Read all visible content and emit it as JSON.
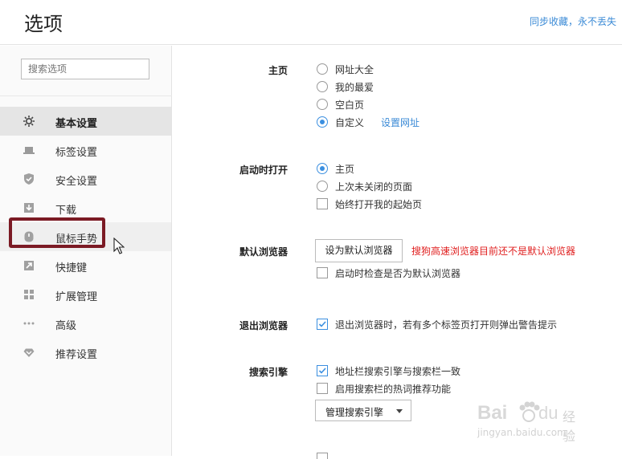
{
  "header": {
    "title": "选项",
    "sync_link": "同步收藏，永不丢失"
  },
  "sidebar": {
    "search_placeholder": "搜索选项",
    "items": [
      {
        "label": "基本设置",
        "icon": "gear-icon"
      },
      {
        "label": "标签设置",
        "icon": "laptop-icon"
      },
      {
        "label": "安全设置",
        "icon": "shield-check-icon"
      },
      {
        "label": "下载",
        "icon": "download-icon"
      },
      {
        "label": "鼠标手势",
        "icon": "mouse-icon"
      },
      {
        "label": "快捷键",
        "icon": "shortcut-arrow-icon"
      },
      {
        "label": "扩展管理",
        "icon": "extensions-grid-icon"
      },
      {
        "label": "高级",
        "icon": "more-dots-icon"
      },
      {
        "label": "推荐设置",
        "icon": "heart-icon"
      }
    ],
    "active_index": 0,
    "highlighted_index": 4
  },
  "homepage": {
    "label": "主页",
    "options": [
      "网址大全",
      "我的最爱",
      "空白页",
      "自定义"
    ],
    "selected": "自定义",
    "set_url_link": "设置网址"
  },
  "startup": {
    "label": "启动时打开",
    "options": [
      "主页",
      "上次未关闭的页面"
    ],
    "selected": "主页",
    "always_open_start": {
      "label": "始终打开我的起始页",
      "checked": false
    }
  },
  "default_browser": {
    "label": "默认浏览器",
    "button": "设为默认浏览器",
    "warning": "搜狗高速浏览器目前还不是默认浏览器",
    "check_on_start": {
      "label": "启动时检查是否为默认浏览器",
      "checked": false
    }
  },
  "exit_browser": {
    "label": "退出浏览器",
    "warn_multi_tabs": {
      "label": "退出浏览器时，若有多个标签页打开则弹出警告提示",
      "checked": true
    }
  },
  "search_engine": {
    "label": "搜索引擎",
    "sync_address_bar": {
      "label": "地址栏搜索引擎与搜索栏一致",
      "checked": true
    },
    "hot_words": {
      "label": "启用搜索栏的热词推荐功能",
      "checked": false
    },
    "manage_button": "管理搜索引擎"
  },
  "watermark": {
    "brand": "Bai du 经验",
    "url": "jingyan.baidu.com"
  },
  "colors": {
    "accent": "#3b8fe0",
    "link": "#3a8ad6",
    "warning": "#e02020",
    "highlight_box": "#7b1a24"
  }
}
